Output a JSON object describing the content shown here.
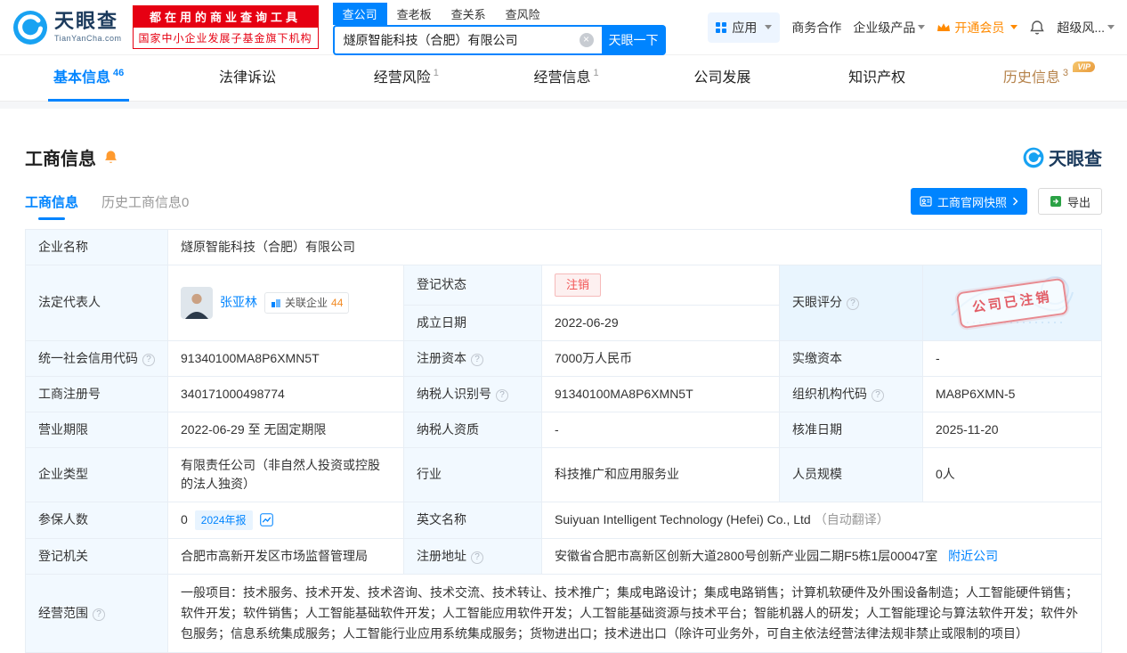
{
  "colors": {
    "accent": "#0084ff",
    "brand_red": "#e60012",
    "status_red": "#f25555",
    "vip_gold": "#b5824a",
    "member_orange": "#ff8a00",
    "export_green": "#2ba245",
    "label_bg": "#f2f9ff"
  },
  "header": {
    "brand": "天眼查",
    "brand_domain": "TianYanCha.com",
    "promo_line1": "都在用的商业查询工具",
    "promo_line2": "国家中小企业发展子基金旗下机构",
    "search_tabs": [
      {
        "label": "查公司"
      },
      {
        "label": "查老板"
      },
      {
        "label": "查关系"
      },
      {
        "label": "查风险"
      }
    ],
    "search_value": "燧原智能科技（合肥）有限公司",
    "search_button": "天眼一下",
    "menu": {
      "apps": "应用",
      "cooperation": "商务合作",
      "enterprise": "企业级产品",
      "vip": "开通会员",
      "risk": "超级风..."
    }
  },
  "nav": {
    "vip_badge": "VIP",
    "tabs": [
      {
        "label": "基本信息",
        "count": "46"
      },
      {
        "label": "法律诉讼",
        "count": ""
      },
      {
        "label": "经营风险",
        "count": "1"
      },
      {
        "label": "经营信息",
        "count": "1"
      },
      {
        "label": "公司发展",
        "count": ""
      },
      {
        "label": "知识产权",
        "count": ""
      },
      {
        "label": "历史信息",
        "count": "3"
      }
    ]
  },
  "section": {
    "title": "工商信息",
    "brand": "天眼查",
    "tabs": [
      {
        "label": "工商信息"
      },
      {
        "label": "历史工商信息0"
      }
    ],
    "snapshot_button": "工商官网快照",
    "export_button": "导出"
  },
  "info": {
    "company_name_label": "企业名称",
    "company_name": "燧原智能科技（合肥）有限公司",
    "legal_rep_label": "法定代表人",
    "legal_rep_name": "张亚林",
    "related_label": "关联企业",
    "related_count": "44",
    "status_label": "登记状态",
    "status_value": "注销",
    "score_label": "天眼评分",
    "stamp": "公司已注销",
    "established_label": "成立日期",
    "established_value": "2022-06-29",
    "credit_code_label": "统一社会信用代码",
    "credit_code_value": "91340100MA8P6XMN5T",
    "reg_capital_label": "注册资本",
    "reg_capital_value": "7000万人民币",
    "paid_capital_label": "实缴资本",
    "paid_capital_value": "-",
    "reg_number_label": "工商注册号",
    "reg_number_value": "340171000498774",
    "taxpayer_id_label": "纳税人识别号",
    "taxpayer_id_value": "91340100MA8P6XMN5T",
    "org_code_label": "组织机构代码",
    "org_code_value": "MA8P6XMN-5",
    "term_label": "营业期限",
    "term_value": "2022-06-29 至 无固定期限",
    "taxpayer_quality_label": "纳税人资质",
    "taxpayer_quality_value": "-",
    "approval_date_label": "核准日期",
    "approval_date_value": "2025-11-20",
    "company_type_label": "企业类型",
    "company_type_value": "有限责任公司（非自然人投资或控股的法人独资）",
    "industry_label": "行业",
    "industry_value": "科技推广和应用服务业",
    "staff_size_label": "人员规模",
    "staff_size_value": "0人",
    "insured_label": "参保人数",
    "insured_value": "0",
    "insured_badge": "2024年报",
    "english_name_label": "英文名称",
    "english_name_value": "Suiyuan Intelligent Technology (Hefei) Co., Ltd",
    "english_name_note": "（自动翻译）",
    "authority_label": "登记机关",
    "authority_value": "合肥市高新开发区市场监督管理局",
    "address_label": "注册地址",
    "address_value": "安徽省合肥市高新区创新大道2800号创新产业园二期F5栋1层00047室",
    "address_link": "附近公司",
    "scope_label": "经营范围",
    "scope_value": "一般项目：技术服务、技术开发、技术咨询、技术交流、技术转让、技术推广；集成电路设计；集成电路销售；计算机软硬件及外围设备制造；人工智能硬件销售；软件开发；软件销售；人工智能基础软件开发；人工智能应用软件开发；人工智能基础资源与技术平台；智能机器人的研发；人工智能理论与算法软件开发；软件外包服务；信息系统集成服务；人工智能行业应用系统集成服务；货物进出口；技术进出口（除许可业务外，可自主依法经营法律法规非禁止或限制的项目）"
  }
}
